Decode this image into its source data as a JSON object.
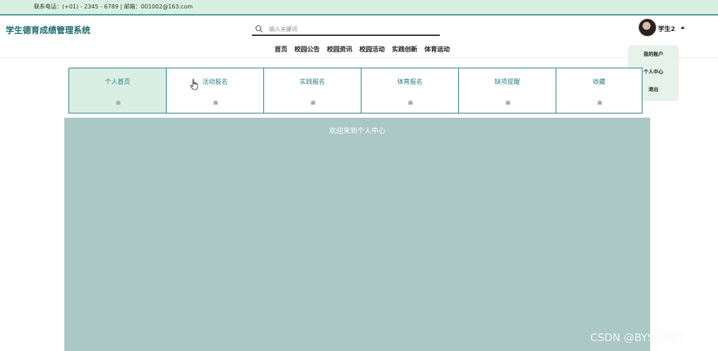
{
  "topbar": {
    "contact": "联系电话：(+01) - 2345 - 6789 | 邮箱：001002@163.com"
  },
  "header": {
    "title": "学生德育成绩管理系统",
    "search": {
      "placeholder": "输入关键词",
      "value": ""
    },
    "user": {
      "name": "学生2"
    }
  },
  "nav": {
    "items": [
      "首页",
      "校园公告",
      "校园资讯",
      "校园活动",
      "实践创新",
      "体育运动"
    ]
  },
  "dropdown": {
    "items": [
      "我的账户",
      "个人中心",
      "退出"
    ]
  },
  "tabs": [
    {
      "label": "个人首页",
      "active": true
    },
    {
      "label": "活动报名",
      "active": false
    },
    {
      "label": "实践报名",
      "active": false
    },
    {
      "label": "体育报名",
      "active": false
    },
    {
      "label": "缺项提醒",
      "active": false
    },
    {
      "label": "收藏",
      "active": false
    }
  ],
  "main": {
    "welcome": "欢迎来到个人中心"
  },
  "watermark": "CSDN @BYSJ1987",
  "colors": {
    "accent": "#2f7f86",
    "topbar_bg": "#d9efe3",
    "main_bg": "#abc8c4",
    "title": "#1d6b6b"
  }
}
